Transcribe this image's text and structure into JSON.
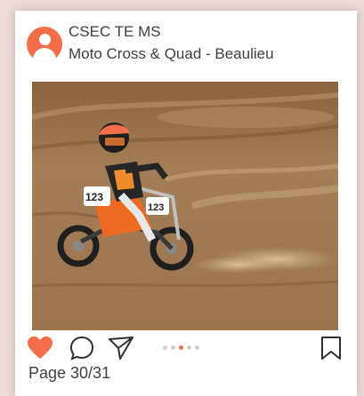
{
  "post": {
    "account": "CSEC TE MS",
    "location": "Moto Cross & Quad - Beaulieu",
    "image_alt": "Motocross rider",
    "bike_number": "123",
    "liked": true,
    "carousel": {
      "count": 5,
      "active_index": 2
    },
    "page_label": "Page 30/31"
  },
  "icons": {
    "avatar": "user-icon",
    "like": "heart-icon",
    "comment": "comment-icon",
    "share": "send-icon",
    "save": "bookmark-icon"
  },
  "colors": {
    "accent": "#f36f4a",
    "text": "#404040",
    "background": "#ecdcd9",
    "dot_inactive": "#cfcfcf"
  }
}
